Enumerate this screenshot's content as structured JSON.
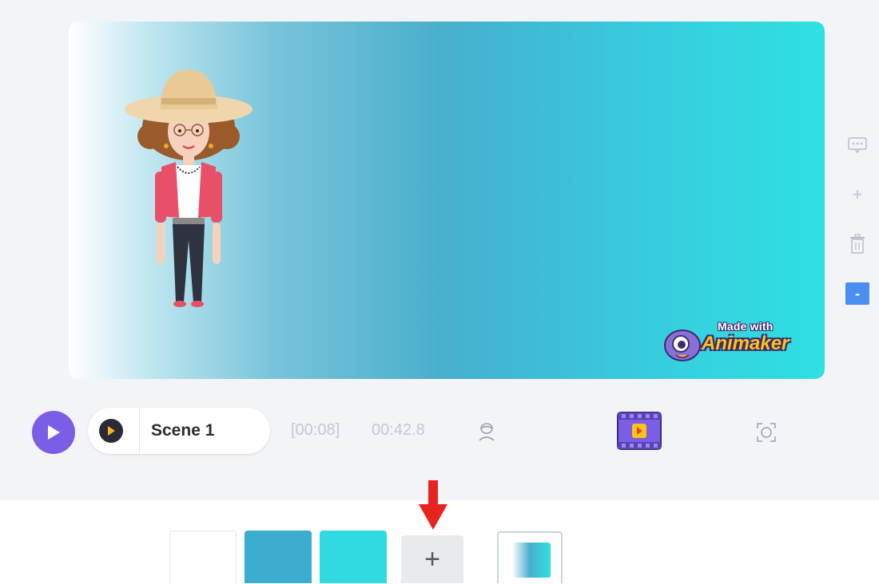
{
  "canvas": {
    "gradient_colors": [
      "#ffffff",
      "#4aafcc",
      "#2fe0e1"
    ],
    "character": "woman-with-sun-hat",
    "watermark": {
      "line1": "Made with",
      "line2": "Animaker"
    }
  },
  "side_tools": [
    {
      "icon": "comment-icon"
    },
    {
      "icon": "plus-icon",
      "label": "+"
    },
    {
      "icon": "trash-icon"
    },
    {
      "icon": "minus-icon",
      "label": "-"
    }
  ],
  "timeline": {
    "scene_name": "Scene 1",
    "total_time": "[00:08]",
    "current_time": "00:42.8",
    "accent_color": "#7b5de6"
  },
  "background_swatches": {
    "colors": [
      "#ffffff",
      "#3dadcf",
      "#2fdbe0"
    ],
    "add_label": "+",
    "highlight_arrow_color": "#e8231e"
  }
}
